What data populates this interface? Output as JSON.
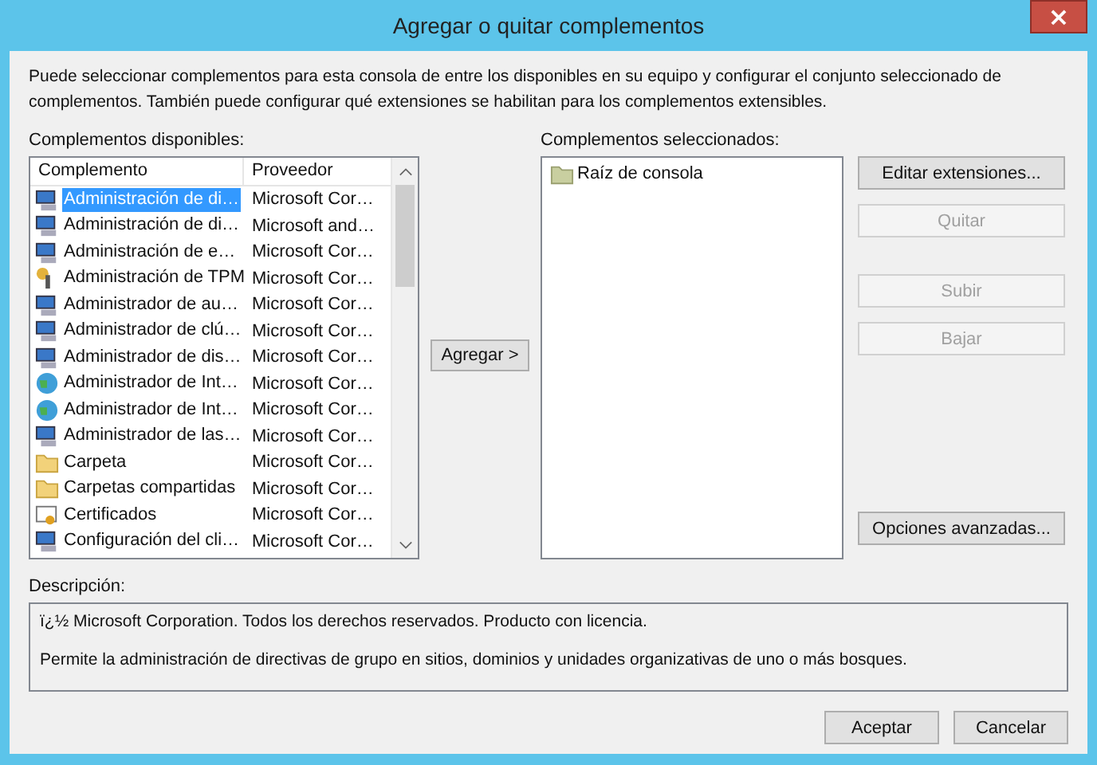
{
  "window": {
    "title": "Agregar o quitar complementos",
    "close": "×"
  },
  "intro": "Puede seleccionar complementos para esta consola de entre los disponibles en su equipo y configurar el conjunto seleccionado de complementos. También puede configurar qué extensiones se habilitan para los complementos extensibles.",
  "available": {
    "label": "Complementos disponibles:",
    "columns": [
      "Complemento",
      "Proveedor"
    ],
    "rows": [
      {
        "name": "Administración de di…",
        "vendor": "Microsoft Cor…",
        "selected": true
      },
      {
        "name": "Administración de di…",
        "vendor": "Microsoft and…",
        "selected": false
      },
      {
        "name": "Administración de e…",
        "vendor": "Microsoft Cor…",
        "selected": false
      },
      {
        "name": "Administración de TPM",
        "vendor": "Microsoft Cor…",
        "selected": false
      },
      {
        "name": "Administrador de au…",
        "vendor": "Microsoft Cor…",
        "selected": false
      },
      {
        "name": "Administrador de clú…",
        "vendor": "Microsoft Cor…",
        "selected": false
      },
      {
        "name": "Administrador de dis…",
        "vendor": "Microsoft Cor…",
        "selected": false
      },
      {
        "name": "Administrador de Int…",
        "vendor": "Microsoft Cor…",
        "selected": false
      },
      {
        "name": "Administrador de Int…",
        "vendor": "Microsoft Cor…",
        "selected": false
      },
      {
        "name": "Administrador de las…",
        "vendor": "Microsoft Cor…",
        "selected": false
      },
      {
        "name": "Carpeta",
        "vendor": "Microsoft Cor…",
        "selected": false
      },
      {
        "name": "Carpetas compartidas",
        "vendor": "Microsoft Cor…",
        "selected": false
      },
      {
        "name": "Certificados",
        "vendor": "Microsoft Cor…",
        "selected": false
      },
      {
        "name": "Configuración del cli…",
        "vendor": "Microsoft Cor…",
        "selected": false
      }
    ]
  },
  "add_button": "Agregar >",
  "selected_snapins": {
    "label": "Complementos seleccionados:",
    "items": [
      "Raíz de consola"
    ]
  },
  "side_buttons": [
    {
      "label": "Editar extensiones...",
      "disabled": false
    },
    {
      "label": "Quitar",
      "disabled": true
    },
    {
      "label": "Subir",
      "disabled": true
    },
    {
      "label": "Bajar",
      "disabled": true
    }
  ],
  "advanced_button": "Opciones avanzadas...",
  "description": {
    "label": "Descripción:",
    "lines": [
      "ï¿½ Microsoft Corporation. Todos los derechos reservados. Producto con licencia.",
      "Permite la administración de directivas de grupo en sitios, dominios y unidades organizativas de uno o más bosques."
    ]
  },
  "footer_buttons": [
    "Aceptar",
    "Cancelar"
  ]
}
